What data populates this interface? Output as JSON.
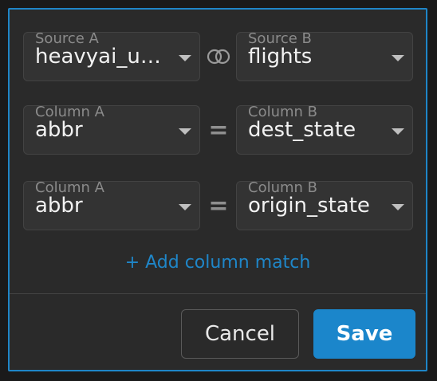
{
  "source_row": {
    "source_a": {
      "label": "Source A",
      "value": "heavyai_us_..."
    },
    "join_icon": "link-rings-icon",
    "source_b": {
      "label": "Source B",
      "value": "flights"
    }
  },
  "matches": [
    {
      "column_a": {
        "label": "Column A",
        "value": "abbr"
      },
      "operator": "=",
      "column_b": {
        "label": "Column B",
        "value": "dest_state"
      }
    },
    {
      "column_a": {
        "label": "Column A",
        "value": "abbr"
      },
      "operator": "=",
      "column_b": {
        "label": "Column B",
        "value": "origin_state"
      }
    }
  ],
  "add_column_match_label": "+ Add column match",
  "actions": {
    "cancel_label": "Cancel",
    "save_label": "Save"
  },
  "colors": {
    "accent": "#1f86c8",
    "save_bg": "#1b86cb",
    "panel_bg": "#2a2a2a",
    "select_bg": "#333333"
  }
}
